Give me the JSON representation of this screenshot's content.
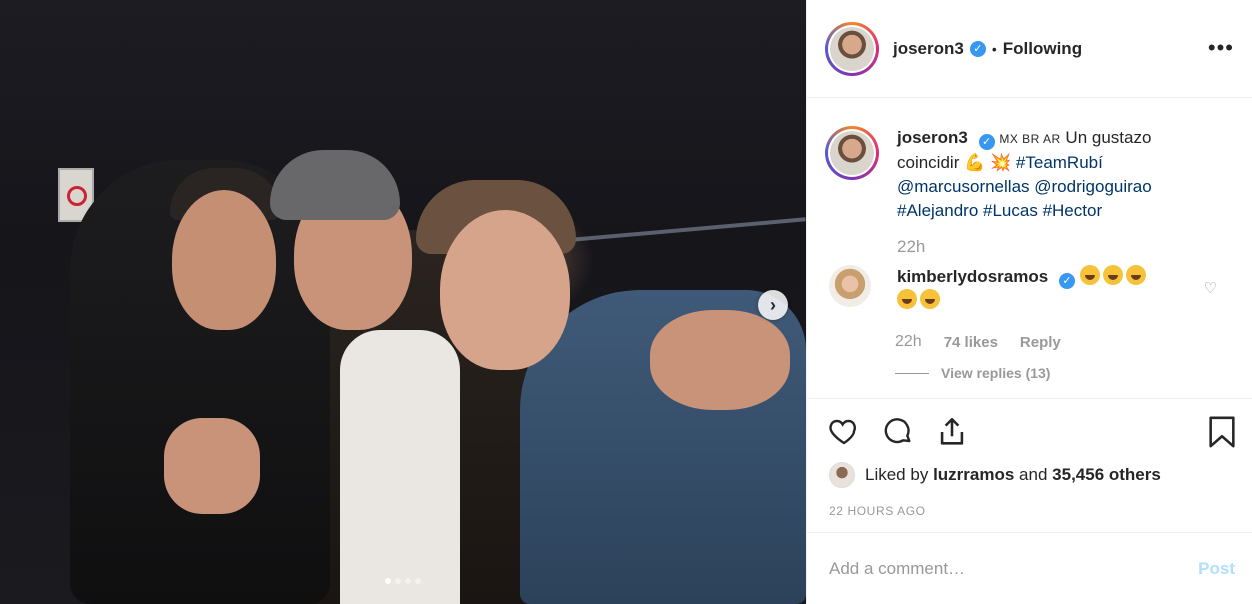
{
  "post": {
    "username": "joseron3",
    "follow_status": "Following",
    "separator": "•",
    "more_icon": "more-dots-icon",
    "carousel_dot_count": 4,
    "carousel_active_index": 0
  },
  "caption": {
    "username": "joseron3",
    "flags": "MX BR AR",
    "text_1": "Un gustazo coincidir",
    "emoji_1": "💪",
    "emoji_2": "💥",
    "hashtag_teamrubi": "#TeamRubí",
    "mention_1": "@marcusornellas",
    "mention_2": "@rodrigoguirao",
    "hashtag_alejandro": "#Alejandro",
    "hashtag_lucas": "#Lucas",
    "hashtag_hector": "#Hector",
    "time": "22h"
  },
  "comment": {
    "username": "kimberlydosramos",
    "emoji_count": 5,
    "time": "22h",
    "likes": "74 likes",
    "reply": "Reply",
    "view_replies": "View replies (13)"
  },
  "liked_by": {
    "prefix": "Liked by",
    "user": "luzrramos",
    "middle": "and",
    "others": "35,456 others"
  },
  "timestamp": "22 HOURS AGO",
  "add_comment": {
    "placeholder": "Add a comment…",
    "post_label": "Post"
  },
  "colors": {
    "link": "#003569",
    "verified": "#3897f0",
    "muted": "#999999",
    "post_disabled": "#b2dffc"
  }
}
